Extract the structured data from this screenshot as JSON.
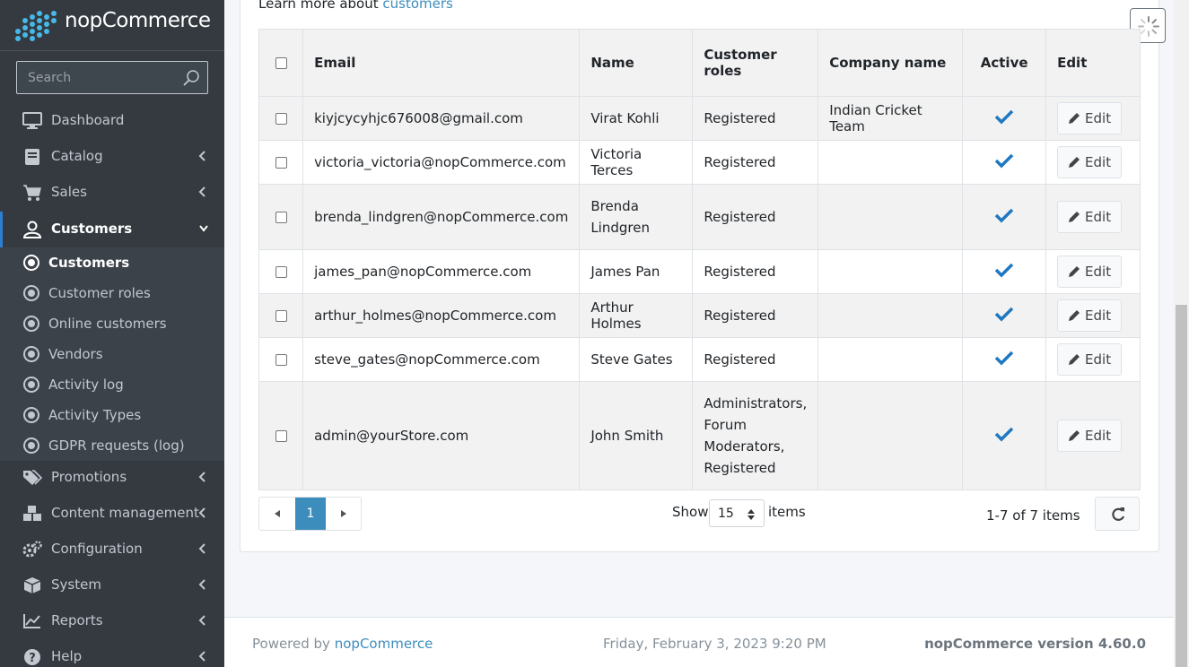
{
  "brand": {
    "name": "nopCommerce"
  },
  "search": {
    "placeholder": "Search"
  },
  "nav": [
    {
      "label": "Dashboard",
      "icon": "desktop-icon"
    },
    {
      "label": "Catalog",
      "icon": "book-icon"
    },
    {
      "label": "Sales",
      "icon": "cart-icon"
    },
    {
      "label": "Customers",
      "icon": "user-icon",
      "active": true
    },
    {
      "label": "Promotions",
      "icon": "tags-icon"
    },
    {
      "label": "Content management",
      "icon": "cubes-icon"
    },
    {
      "label": "Configuration",
      "icon": "cogs-icon"
    },
    {
      "label": "System",
      "icon": "cube-icon"
    },
    {
      "label": "Reports",
      "icon": "line-chart-icon"
    },
    {
      "label": "Help",
      "icon": "question-circle-icon"
    }
  ],
  "subnav": [
    {
      "label": "Customers",
      "current": true
    },
    {
      "label": "Customer roles"
    },
    {
      "label": "Online customers"
    },
    {
      "label": "Vendors"
    },
    {
      "label": "Activity log"
    },
    {
      "label": "Activity Types"
    },
    {
      "label": "GDPR requests (log)"
    }
  ],
  "learn": {
    "prefix": "Learn more about",
    "link": "customers"
  },
  "table": {
    "headers": {
      "email": "Email",
      "name": "Name",
      "roles": "Customer roles",
      "company": "Company name",
      "active": "Active",
      "edit": "Edit"
    },
    "edit_label": "Edit",
    "rows": [
      {
        "email": "kiyjcycyhjc676008@gmail.com",
        "name": "Virat Kohli",
        "roles": "Registered",
        "company": "Indian Cricket Team",
        "active": true
      },
      {
        "email": "victoria_victoria@nopCommerce.com",
        "name": "Victoria Terces",
        "roles": "Registered",
        "company": "",
        "active": true
      },
      {
        "email": "brenda_lindgren@nopCommerce.com",
        "name": "Brenda Lindgren",
        "roles": "Registered",
        "company": "",
        "active": true
      },
      {
        "email": "james_pan@nopCommerce.com",
        "name": "James Pan",
        "roles": "Registered",
        "company": "",
        "active": true
      },
      {
        "email": "arthur_holmes@nopCommerce.com",
        "name": "Arthur Holmes",
        "roles": "Registered",
        "company": "",
        "active": true
      },
      {
        "email": "steve_gates@nopCommerce.com",
        "name": "Steve Gates",
        "roles": "Registered",
        "company": "",
        "active": true
      },
      {
        "email": "admin@yourStore.com",
        "name": "John Smith",
        "roles": "Administrators, Forum Moderators, Registered",
        "company": "",
        "active": true
      }
    ]
  },
  "pager": {
    "current_page": "1",
    "show_label": "Show",
    "page_size": "15",
    "items_label": "items",
    "count_text": "1-7 of 7 items"
  },
  "footer": {
    "powered_prefix": "Powered by",
    "powered_link": "nopCommerce",
    "date": "Friday, February 3, 2023 9:20 PM",
    "version": "nopCommerce version 4.60.0"
  },
  "colors": {
    "sidebar": "#343a40",
    "accent": "#3c8dbc",
    "check": "#1f78c1"
  }
}
